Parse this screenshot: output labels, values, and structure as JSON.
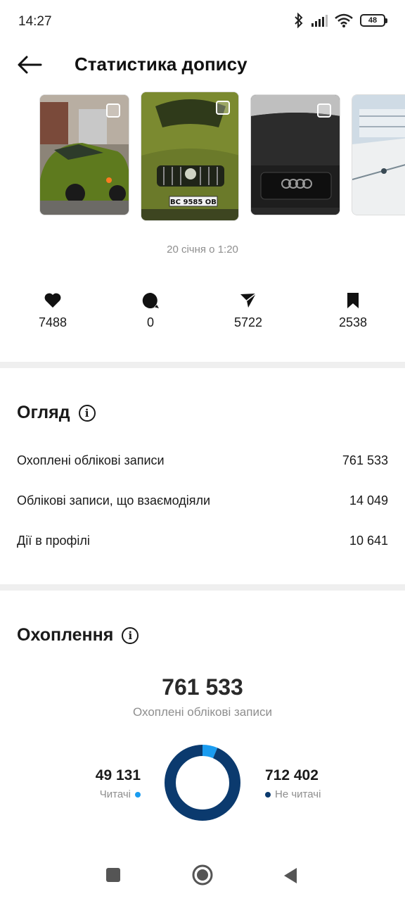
{
  "status_bar": {
    "time": "14:27",
    "battery": "48"
  },
  "header": {
    "title": "Статистика допису"
  },
  "post": {
    "date": "20 січня о 1:20",
    "thumbnails": [
      {
        "name": "green-bmw-photo"
      },
      {
        "name": "green-skoda-photo",
        "plate": "BC 9585 OB"
      },
      {
        "name": "black-audi-photo"
      },
      {
        "name": "ship-photo"
      }
    ]
  },
  "metrics": {
    "likes": "7488",
    "comments": "0",
    "shares": "5722",
    "saves": "2538"
  },
  "overview": {
    "title": "Огляд",
    "rows": [
      {
        "label": "Охоплені облікові записи",
        "value": "761 533"
      },
      {
        "label": "Облікові записи, що взаємодіяли",
        "value": "14 049"
      },
      {
        "label": "Дії в профілі",
        "value": "10 641"
      }
    ]
  },
  "reach": {
    "title": "Охоплення",
    "total": "761 533",
    "total_label": "Охоплені облікові записи",
    "followers_value": "49 131",
    "followers_label": "Читачі",
    "non_followers_value": "712 402",
    "non_followers_label": "Не читачі",
    "colors": {
      "followers": "#1a9cf0",
      "non_followers": "#0b3a6e"
    }
  },
  "chart_data": {
    "type": "pie",
    "categories": [
      "Читачі",
      "Не читачі"
    ],
    "values": [
      49131,
      712402
    ]
  }
}
